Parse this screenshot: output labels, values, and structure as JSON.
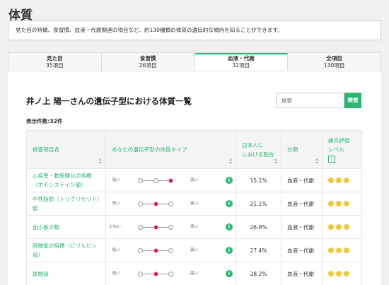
{
  "page": {
    "title": "体質"
  },
  "intro": {
    "text": "見た目の特徴、食習慣、血液・代謝関連の項目など、約130種類の体質の遺伝的な傾向を知ることができます。"
  },
  "tabs": [
    {
      "label": "見た目",
      "count": "35項目",
      "active": false
    },
    {
      "label": "食習慣",
      "count": "26項目",
      "active": false
    },
    {
      "label": "血液・代謝",
      "count": "32項目",
      "active": true
    },
    {
      "label": "全項目",
      "count": "130項目",
      "active": false
    }
  ],
  "report": {
    "title": "井ノ上 陽一さんの遺伝子型における体質一覧",
    "search_placeholder": "検索",
    "search_button": "検索",
    "count_text": "表示件数:32件"
  },
  "table": {
    "headers": {
      "name": "検査項目名",
      "genotype": "あなたの遺伝子型の体質タイプ",
      "ratio_line1": "日本人に",
      "ratio_line2": "における割合",
      "category": "分類",
      "evidence_line1": "論文評価",
      "evidence_line2": "レベル",
      "help": "?"
    },
    "rows": [
      {
        "name": "心疾患・動脈硬化の指標（ホモシステイン値）",
        "low": "低い",
        "high": "高い",
        "selected": 2,
        "ratio": "15.1%",
        "category": "血液・代謝",
        "stars": 3
      },
      {
        "name": "中性脂肪（トリグリセリド）値",
        "low": "低い",
        "high": "高い",
        "selected": 1,
        "ratio": "21.1%",
        "category": "血液・代謝",
        "stars": 3
      },
      {
        "name": "血小板の数",
        "low": "少ない",
        "high": "多い",
        "selected": 1,
        "ratio": "26.9%",
        "category": "血液・代謝",
        "stars": 3
      },
      {
        "name": "肝機能の指標（ビリルビン値）",
        "low": "低い",
        "high": "高い",
        "selected": 1,
        "ratio": "27.4%",
        "category": "血液・代謝",
        "stars": 3
      },
      {
        "name": "尿酸値",
        "low": "低い",
        "high": "高い",
        "selected": 1,
        "ratio": "28.2%",
        "category": "血液・代謝",
        "stars": 3
      }
    ]
  },
  "icons": {
    "info": "info-icon",
    "sort": "sort-icon",
    "evidence_dot": "evidence-dot-icon"
  },
  "colors": {
    "accent": "#2bb673",
    "selected_dot": "#c8174f",
    "star": "#f0c93a"
  }
}
